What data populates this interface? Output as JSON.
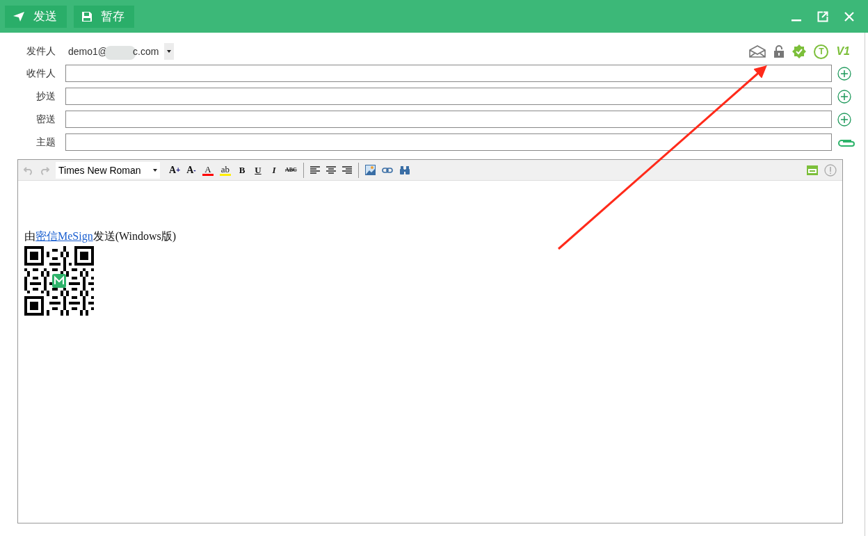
{
  "toolbar": {
    "buttons": [
      {
        "kind": "send",
        "label": "发送"
      },
      {
        "kind": "save",
        "label": "暂存"
      }
    ],
    "window_controls": [
      {
        "kind": "minimize"
      },
      {
        "kind": "popout"
      },
      {
        "kind": "close"
      }
    ]
  },
  "header": {
    "sender": {
      "label": "发件人",
      "value_start": "demo1@",
      "value_end": "c.com",
      "blurred": true
    },
    "status_icons": [
      {
        "kind": "envelope"
      },
      {
        "kind": "lock"
      },
      {
        "kind": "verified"
      },
      {
        "kind": "circle-letter",
        "label": "T"
      },
      {
        "kind": "letter",
        "label": "V1"
      }
    ],
    "fields": [
      {
        "label": "收件人",
        "kind": "recipient"
      },
      {
        "label": "抄送",
        "kind": "recipient"
      },
      {
        "label": "密送",
        "kind": "recipient"
      },
      {
        "label": "主题",
        "kind": "subject"
      }
    ]
  },
  "editor": {
    "toolbar": [
      {
        "kind": "undo",
        "disabled": true
      },
      {
        "kind": "redo",
        "disabled": true
      },
      {
        "kind": "select",
        "value": "Times New Roman"
      },
      {
        "kind": "grow",
        "label": "A",
        "mark": "+"
      },
      {
        "kind": "shrink",
        "label": "A",
        "mark": "-"
      },
      {
        "kind": "fontcolor",
        "label": "A",
        "color": "#ff0000"
      },
      {
        "kind": "highlight",
        "label": "ab",
        "color": "#ffee00"
      },
      {
        "kind": "bold",
        "label": "B"
      },
      {
        "kind": "underline",
        "label": "U"
      },
      {
        "kind": "italic",
        "label": "I"
      },
      {
        "kind": "strike",
        "label": "ABC"
      },
      {
        "kind": "separator"
      },
      {
        "kind": "alignleft"
      },
      {
        "kind": "aligncenter"
      },
      {
        "kind": "alignright"
      },
      {
        "kind": "separator"
      },
      {
        "kind": "image"
      },
      {
        "kind": "link"
      },
      {
        "kind": "find"
      }
    ],
    "toolbar_right": [
      {
        "kind": "html"
      },
      {
        "kind": "info"
      }
    ],
    "signature": {
      "before": "由",
      "link": "密信MeSign",
      "after": "发送(Windows版)"
    }
  },
  "annotations": [
    {
      "kind": "arrow"
    }
  ]
}
